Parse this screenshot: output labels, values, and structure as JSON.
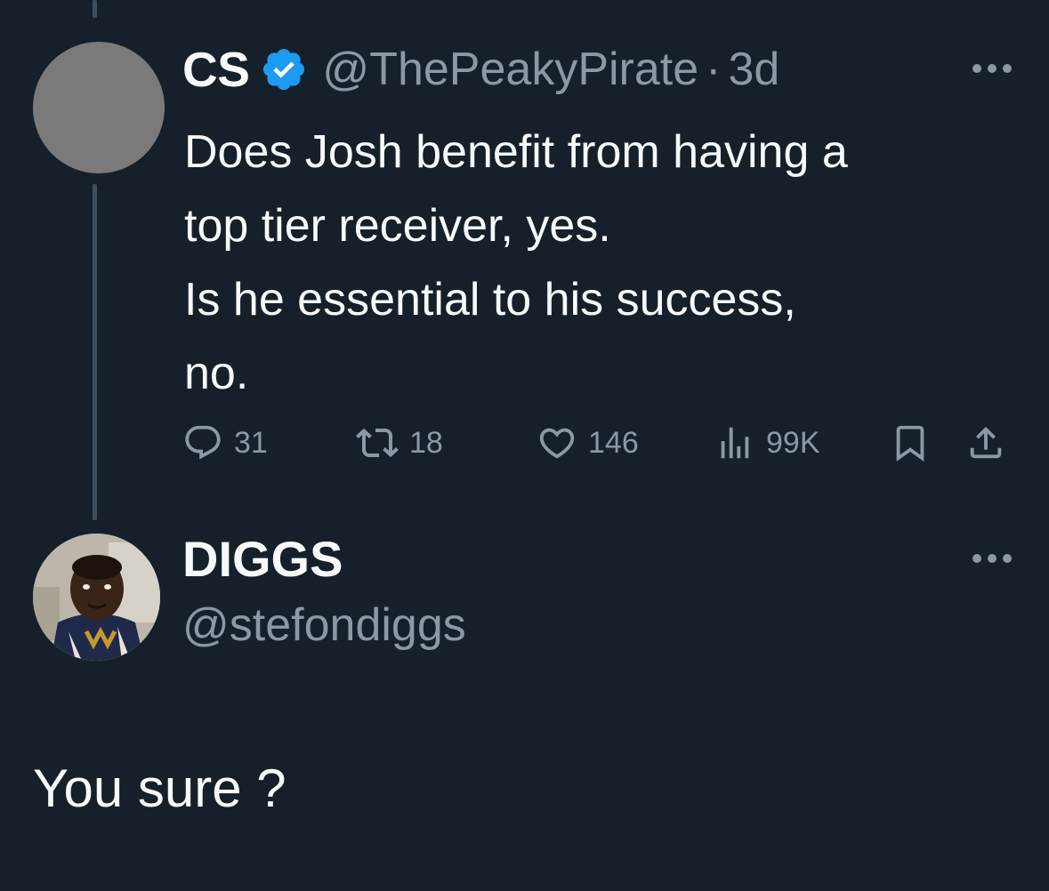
{
  "thread": {
    "parent_tweet": {
      "display_name": "CS",
      "verified": true,
      "verified_icon": "verified-badge-icon",
      "handle": "@ThePeakyPirate",
      "separator": "·",
      "timestamp": "3d",
      "text_lines": [
        "Does Josh benefit from having a",
        "top tier receiver, yes.",
        "Is he essential to his success,",
        "no."
      ],
      "actions": {
        "replies": "31",
        "retweets": "18",
        "likes": "146",
        "views": "99K"
      }
    },
    "reply_tweet": {
      "display_name": "DIGGS",
      "handle": "@stefondiggs",
      "text": "You sure ?"
    }
  },
  "colors": {
    "background": "#15202b",
    "primary_text": "#f7f9f9",
    "secondary_text": "#8b98a5",
    "verified_blue": "#1d9bf0",
    "thread_line": "#3d4f5f"
  }
}
